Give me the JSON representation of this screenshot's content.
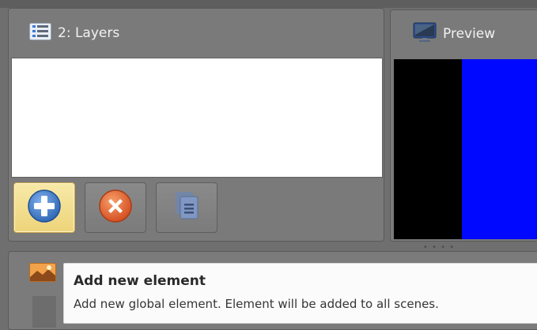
{
  "layers_panel": {
    "title": "2: Layers",
    "icon": "list-icon",
    "buttons": [
      {
        "name": "add-element-button",
        "icon": "plus-circle-icon",
        "active": true
      },
      {
        "name": "remove-element-button",
        "icon": "x-circle-icon",
        "active": false
      },
      {
        "name": "duplicate-element-button",
        "icon": "copy-icon",
        "active": false
      }
    ]
  },
  "preview_panel": {
    "title": "Preview",
    "icon": "monitor-icon"
  },
  "bottom_panel": {
    "icon": "image-icon"
  },
  "tooltip": {
    "title": "Add new element",
    "description": "Add new global element. Element will be added to all scenes."
  },
  "colors": {
    "panel_bg": "#7a7a7a",
    "active_button": "#f0d98a",
    "add_icon_blue": "#2f6fbf",
    "remove_icon_orange": "#e0642a",
    "preview_blue": "#0008ff"
  }
}
